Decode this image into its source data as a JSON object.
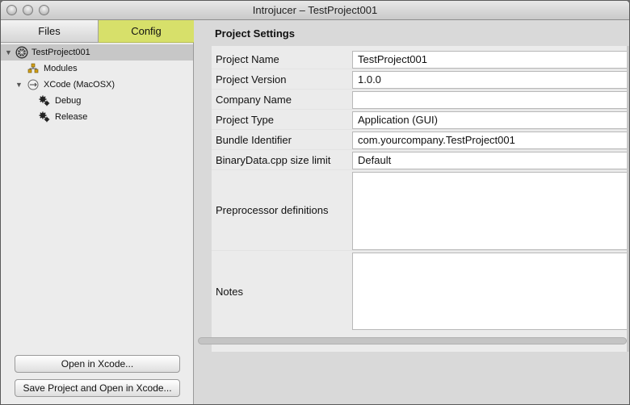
{
  "window": {
    "title": "Introjucer – TestProject001",
    "colors": {
      "config_tab": "#d7e06a",
      "selected_row": "#c7c7c7"
    }
  },
  "sidebar": {
    "tabs": [
      {
        "label": "Files",
        "selected": false
      },
      {
        "label": "Config",
        "selected": true
      }
    ],
    "tree": {
      "project": {
        "label": "TestProject001",
        "icon": "juce-logo-icon"
      },
      "modules": {
        "label": "Modules",
        "icon": "modules-icon"
      },
      "exporter": {
        "label": "XCode (MacOSX)",
        "icon": "xcode-icon"
      },
      "configs": [
        {
          "label": "Debug",
          "icon": "gear-icon"
        },
        {
          "label": "Release",
          "icon": "gear-icon"
        }
      ]
    },
    "buttons": {
      "open": "Open in Xcode...",
      "save_open": "Save Project and Open in Xcode..."
    }
  },
  "settings": {
    "heading": "Project Settings",
    "fields": [
      {
        "label": "Project Name",
        "value": "TestProject001"
      },
      {
        "label": "Project Version",
        "value": "1.0.0"
      },
      {
        "label": "Company Name",
        "value": ""
      },
      {
        "label": "Project Type",
        "value": "Application (GUI)"
      },
      {
        "label": "Bundle Identifier",
        "value": "com.yourcompany.TestProject001"
      },
      {
        "label": "BinaryData.cpp size limit",
        "value": "Default"
      },
      {
        "label": "Preprocessor definitions",
        "value": ""
      },
      {
        "label": "Notes",
        "value": ""
      }
    ]
  }
}
